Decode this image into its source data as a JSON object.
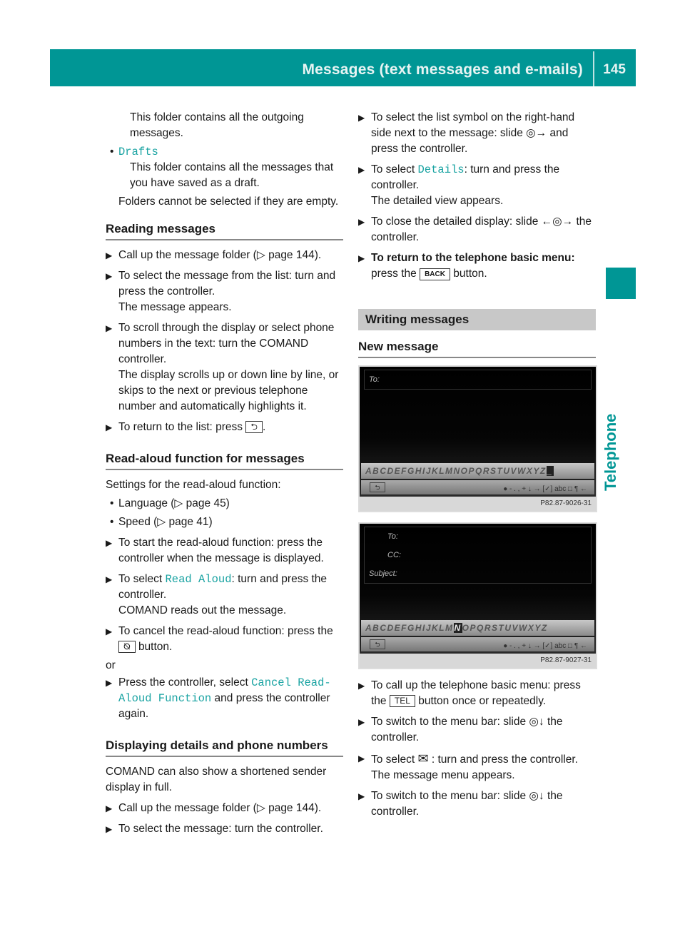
{
  "header": {
    "title": "Messages (text messages and e-mails)",
    "page_number": "145"
  },
  "side_tab": {
    "label": "Telephone",
    "accent": "#009695"
  },
  "left": {
    "outbox_desc": "This folder contains all the outgoing messages.",
    "drafts_label": "Drafts",
    "drafts_desc": "This folder contains all the messages that you have saved as a draft.",
    "folders_note": "Folders cannot be selected if they are empty.",
    "reading": {
      "heading": "Reading messages",
      "s1": "Call up the message folder (▷ page 144).",
      "s2a": "To select the message from the list: turn and press the controller.",
      "s2b": "The message appears.",
      "s3a": "To scroll through the display or select phone numbers in the text: turn the COMAND controller.",
      "s3b": "The display scrolls up or down line by line, or skips to the next or previous telephone number and automatically highlights it.",
      "s4": "To return to the list: press",
      "s4_key": "⮌"
    },
    "readaloud": {
      "heading": "Read-aloud function for messages",
      "intro": "Settings for the read-aloud function:",
      "b1": "Language (▷ page 45)",
      "b2": "Speed (▷ page 41)",
      "s1": "To start the read-aloud function: press the controller when the message is displayed.",
      "s2_pre": "To select ",
      "s2_mono": "Read Aloud",
      "s2_post": ": turn and press the controller.",
      "s2b": "COMAND reads out the message.",
      "s3_pre": "To cancel the read-aloud function: press the",
      "s3_key": "⦰",
      "s3_post": "button.",
      "or": "or",
      "s4_pre": "Press the controller, select ",
      "s4_mono": "Cancel Read-Aloud Function",
      "s4_post": " and press the controller again."
    },
    "details": {
      "heading": "Displaying details and phone numbers",
      "intro": "COMAND can also show a shortened sender display in full.",
      "s1": "Call up the message folder (▷ page 144).",
      "s2": "To select the message: turn the controller."
    }
  },
  "right": {
    "s1": "To select the list symbol on the right-hand side next to the message: slide ◎→ and press the controller.",
    "s2_pre": "To select ",
    "s2_mono": "Details",
    "s2_post": ": turn and press the controller.",
    "s2b": "The detailed view appears.",
    "s3": "To close the detailed display: slide ←◎→ the controller.",
    "s4_bold": "To return to the telephone basic menu:",
    "s4_pre": "press the",
    "s4_key": "BACK",
    "s4_post": "button.",
    "writing_band": "Writing messages",
    "new_message_heading": "New message",
    "screen1": {
      "to": "To:",
      "keyboard": "ABCDEFGHIJKLMNOPQRSTUVWXYZ",
      "selected_key": "_",
      "code": "P82.87-9026-31"
    },
    "screen2": {
      "to": "To:",
      "cc": "CC:",
      "subject": "Subject:",
      "keyboard_pre": "ABCDEFGHIJKLM",
      "selected_key": "N",
      "keyboard_post": "OPQRSTUVWXYZ",
      "code": "P82.87-9027-31"
    },
    "toolbar_symbols": "● - . , + ↓ → [✓] abc □ ¶ ←",
    "t1_pre": "To call up the telephone basic menu: press the",
    "t1_key": "TEL",
    "t1_post": "button once or repeatedly.",
    "t2": "To switch to the menu bar: slide ◎↓ the controller.",
    "t3_pre": "To select",
    "t3_icon": "✉",
    "t3_post": ": turn and press the controller.",
    "t3b": "The message menu appears.",
    "t4": "To switch to the menu bar: slide ◎↓ the controller."
  }
}
